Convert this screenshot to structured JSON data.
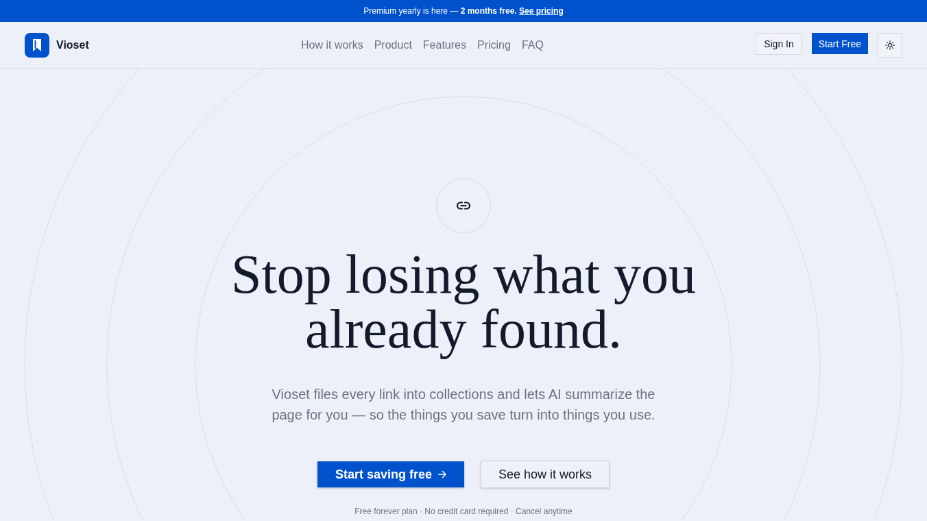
{
  "banner": {
    "text": "Premium yearly is here — **2 months free.**",
    "link": "See pricing"
  },
  "header": {
    "brand": "Vioset",
    "nav": [
      {
        "label": "How it works"
      },
      {
        "label": "Product"
      },
      {
        "label": "Features"
      },
      {
        "label": "Pricing"
      },
      {
        "label": "FAQ"
      }
    ],
    "sign_in": "Sign In",
    "start_free": "Start Free"
  },
  "hero": {
    "headline": "Stop losing what you already found.",
    "subtitle": "Vioset files every link into collections and lets AI summarize the page for you — so the things you save turn into things you use.",
    "primary_cta": "Start saving free",
    "secondary_cta": "See how it works",
    "note": "Free forever plan · No credit card required · Cancel anytime"
  }
}
